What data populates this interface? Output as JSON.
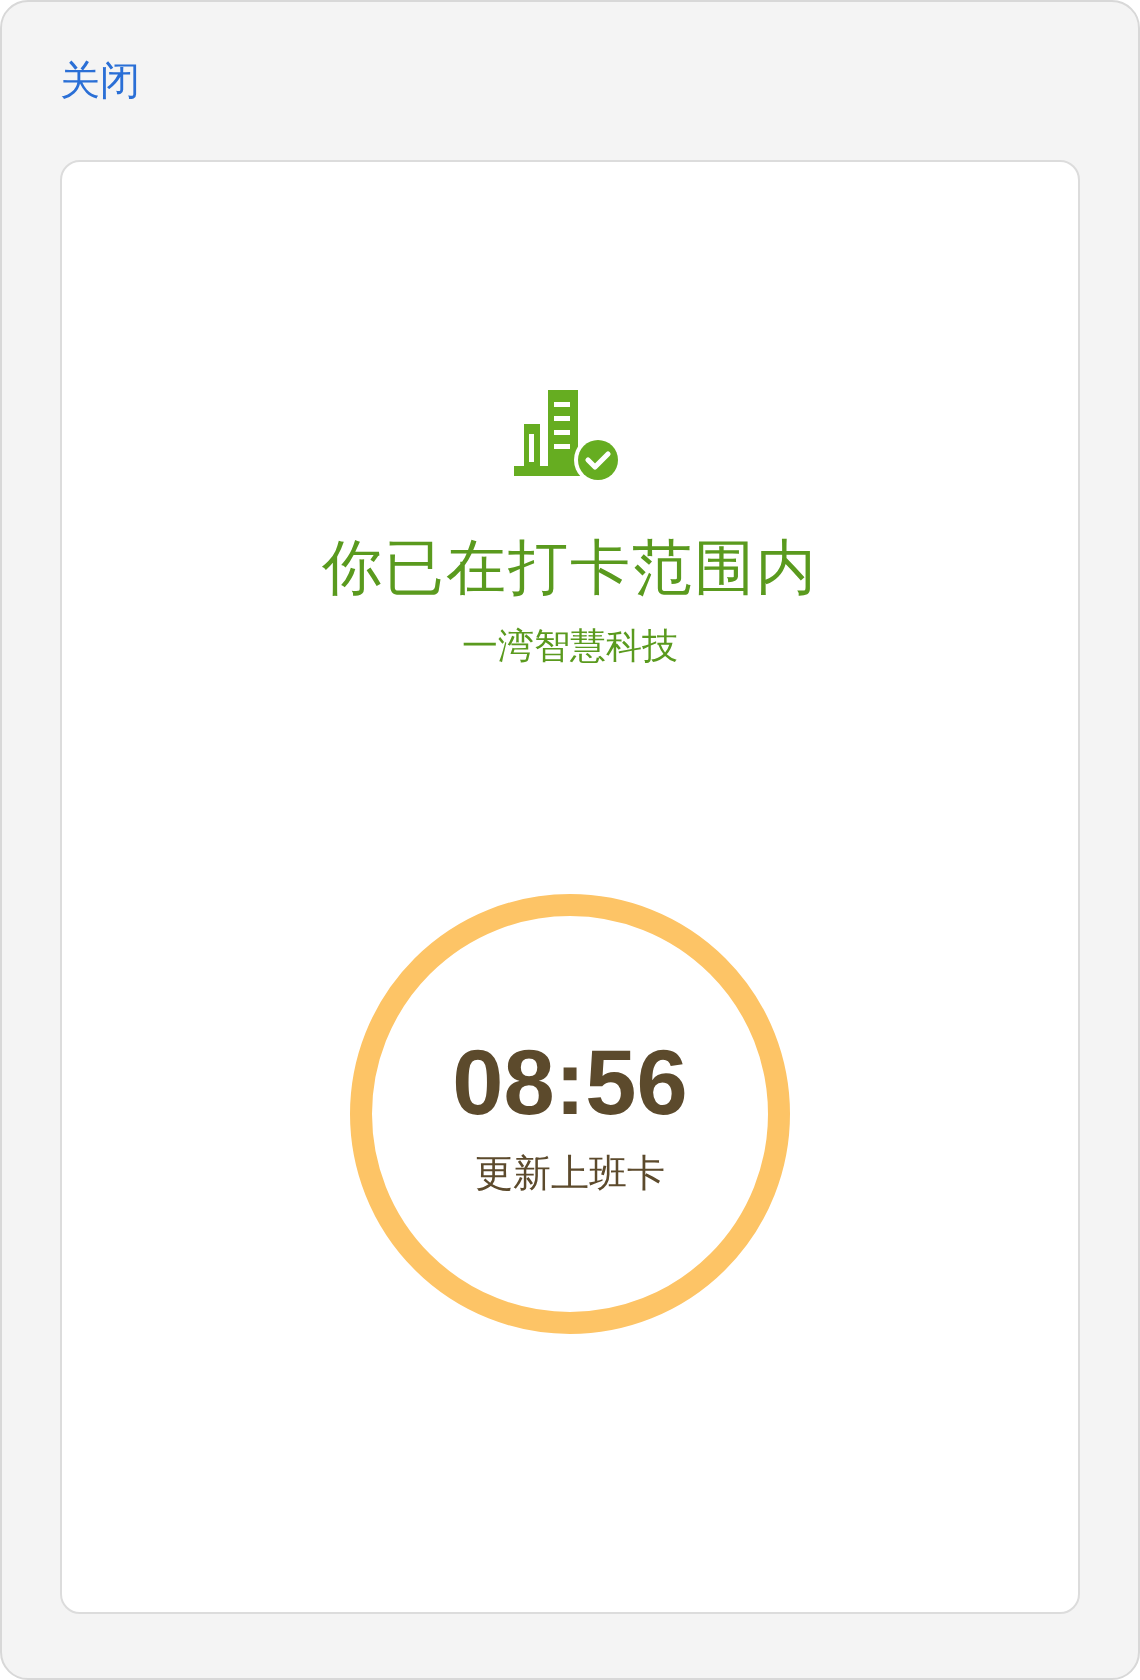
{
  "close_link": "关闭",
  "status": {
    "title": "你已在打卡范围内",
    "company": "一湾智慧科技"
  },
  "punch_button": {
    "time": "08:56",
    "label": "更新上班卡"
  }
}
